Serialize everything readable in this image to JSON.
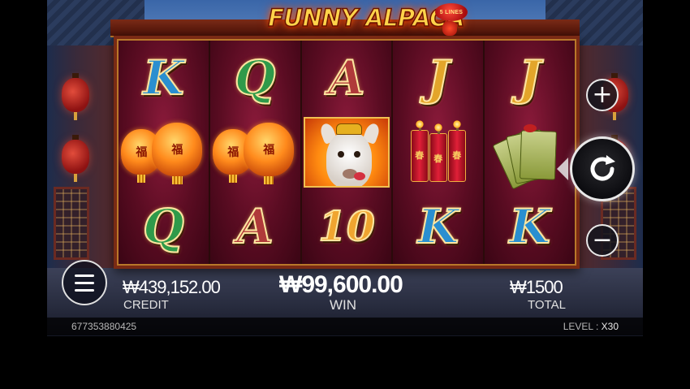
{
  "game": {
    "title": "FUNNY ALPACA",
    "lines_badge": "5 LINES"
  },
  "reels": [
    [
      "K",
      "lanterns",
      "Q"
    ],
    [
      "Q",
      "lanterns",
      "A"
    ],
    [
      "A",
      "alpaca",
      "10"
    ],
    [
      "J",
      "firecrackers",
      "K"
    ],
    [
      "J",
      "money",
      "K"
    ]
  ],
  "symbols": {
    "lantern_char": "福",
    "firecracker_char": "春"
  },
  "controls": {
    "plus_label": "+",
    "minus_label": "−",
    "spin_icon": "refresh-icon",
    "menu_icon": "hamburger-menu-icon"
  },
  "info": {
    "credit_value": "₩439,152.00",
    "credit_label": "CREDIT",
    "win_value": "₩99,600.00",
    "win_label": "WIN",
    "total_value": "₩1500",
    "total_label": "TOTAL"
  },
  "status": {
    "game_id": "677353880425",
    "level_label": "LEVEL :",
    "level_value": "X30"
  },
  "colors": {
    "K": "#2a8fd0",
    "Q": "#2f9a4a",
    "A": "#b03a3a",
    "J": "#e3a52a",
    "10": "#f0a530"
  }
}
